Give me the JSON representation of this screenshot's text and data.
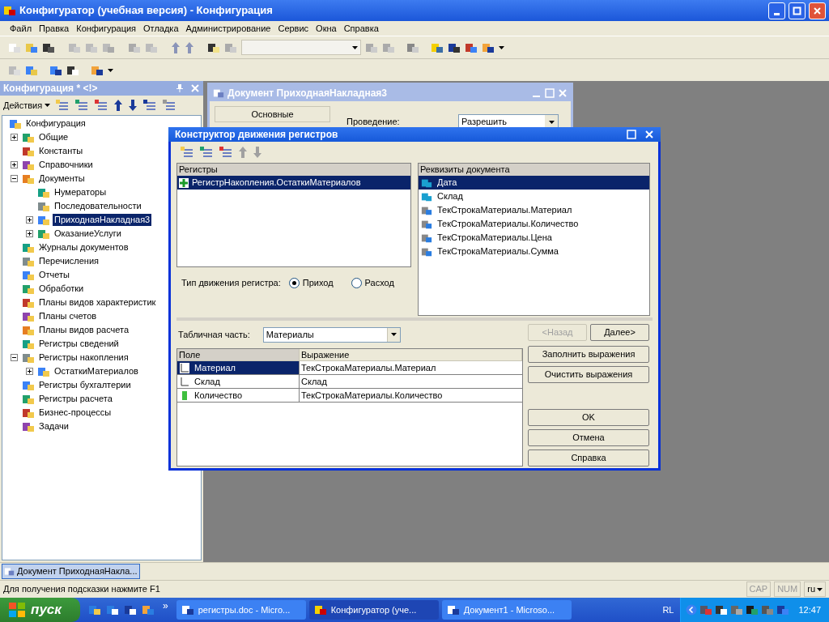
{
  "window": {
    "title": "Конфигуратор (учебная версия) - Конфигурация"
  },
  "menu": [
    "Файл",
    "Правка",
    "Конфигурация",
    "Отладка",
    "Администрирование",
    "Сервис",
    "Окна",
    "Справка"
  ],
  "config_panel": {
    "title": "Конфигурация * <!>",
    "actions_label": "Действия",
    "tree": [
      {
        "label": "Конфигурация",
        "kind": "root",
        "selected": false,
        "children": [
          {
            "label": "Общие",
            "kind": "group",
            "expanded": false,
            "selected": false
          },
          {
            "label": "Константы",
            "kind": "leaf",
            "selected": false
          },
          {
            "label": "Справочники",
            "kind": "group",
            "expanded": false,
            "selected": false
          },
          {
            "label": "Документы",
            "kind": "group",
            "expanded": true,
            "selected": false,
            "children": [
              {
                "label": "Нумераторы",
                "kind": "leaf",
                "selected": false
              },
              {
                "label": "Последовательности",
                "kind": "leaf",
                "selected": false
              },
              {
                "label": "ПриходнаяНакладная3",
                "kind": "group",
                "expanded": false,
                "selected": true
              },
              {
                "label": "ОказаниеУслуги",
                "kind": "group",
                "expanded": false,
                "selected": false
              }
            ]
          },
          {
            "label": "Журналы документов",
            "kind": "leaf",
            "selected": false
          },
          {
            "label": "Перечисления",
            "kind": "leaf",
            "selected": false
          },
          {
            "label": "Отчеты",
            "kind": "leaf",
            "selected": false
          },
          {
            "label": "Обработки",
            "kind": "leaf",
            "selected": false
          },
          {
            "label": "Планы видов характеристик",
            "kind": "leaf",
            "selected": false
          },
          {
            "label": "Планы счетов",
            "kind": "leaf",
            "selected": false
          },
          {
            "label": "Планы видов расчета",
            "kind": "leaf",
            "selected": false
          },
          {
            "label": "Регистры сведений",
            "kind": "leaf",
            "selected": false
          },
          {
            "label": "Регистры накопления",
            "kind": "group",
            "expanded": true,
            "selected": false,
            "children": [
              {
                "label": "ОстаткиМатериалов",
                "kind": "group",
                "expanded": false,
                "selected": false
              }
            ]
          },
          {
            "label": "Регистры бухгалтерии",
            "kind": "leaf",
            "selected": false
          },
          {
            "label": "Регистры расчета",
            "kind": "leaf",
            "selected": false
          },
          {
            "label": "Бизнес-процессы",
            "kind": "leaf",
            "selected": false
          },
          {
            "label": "Задачи",
            "kind": "leaf",
            "selected": false
          }
        ]
      }
    ]
  },
  "document_window": {
    "title": "Документ ПриходнаяНакладная3",
    "tab": "Основные",
    "field_label": "Проведение:",
    "field_value": "Разрешить"
  },
  "dialog": {
    "title": "Конструктор движения регистров",
    "registers": {
      "header": "Регистры",
      "items": [
        {
          "label": "РегистрНакопления.ОстаткиМатериалов",
          "selected": true
        }
      ]
    },
    "attributes": {
      "header": "Реквизиты документа",
      "items": [
        {
          "label": "Дата",
          "selected": true
        },
        {
          "label": "Склад",
          "selected": false
        },
        {
          "label": "ТекСтрокаМатериалы.Материал",
          "selected": false
        },
        {
          "label": "ТекСтрокаМатериалы.Количество",
          "selected": false
        },
        {
          "label": "ТекСтрокаМатериалы.Цена",
          "selected": false
        },
        {
          "label": "ТекСтрокаМатериалы.Сумма",
          "selected": false
        }
      ]
    },
    "movement": {
      "label": "Тип движения регистра:",
      "options": [
        {
          "label": "Приход",
          "selected": true
        },
        {
          "label": "Расход",
          "selected": false
        }
      ]
    },
    "table_part": {
      "label": "Табличная часть:",
      "value": "Материалы"
    },
    "table": {
      "columns": [
        "Поле",
        "Выражение"
      ],
      "rows": [
        {
          "field": "Материал",
          "expression": "ТекСтрокаМатериалы.Материал",
          "selected": true
        },
        {
          "field": "Склад",
          "expression": "Склад",
          "selected": false
        },
        {
          "field": "Количество",
          "expression": "ТекСтрокаМатериалы.Количество",
          "selected": false
        }
      ]
    },
    "nav_buttons": [
      {
        "label": "<Назад",
        "disabled": true
      },
      {
        "label": "Далее>",
        "disabled": false
      }
    ],
    "action_buttons": [
      {
        "label": "Заполнить выражения",
        "disabled": false
      },
      {
        "label": "Очистить выражения",
        "disabled": false
      }
    ],
    "dialog_buttons": [
      {
        "label": "OK",
        "disabled": false
      },
      {
        "label": "Отмена",
        "disabled": false
      },
      {
        "label": "Справка",
        "disabled": false
      }
    ]
  },
  "window_tabs": [
    {
      "label": "Документ ПриходнаяНакла...",
      "selected": true
    }
  ],
  "status_bar": {
    "hint": "Для получения подсказки нажмите F1",
    "indicators": [
      "CAP",
      "NUM"
    ],
    "language": "ru"
  },
  "taskbar": {
    "start": "пуск",
    "overflow": "»",
    "tasks": [
      {
        "label": "регистры.doc - Micro...",
        "selected": false
      },
      {
        "label": "Конфигуратор (уче...",
        "selected": true
      },
      {
        "label": "Документ1 - Microso...",
        "selected": false
      }
    ],
    "tray_label": "RL",
    "clock": "12:47"
  }
}
